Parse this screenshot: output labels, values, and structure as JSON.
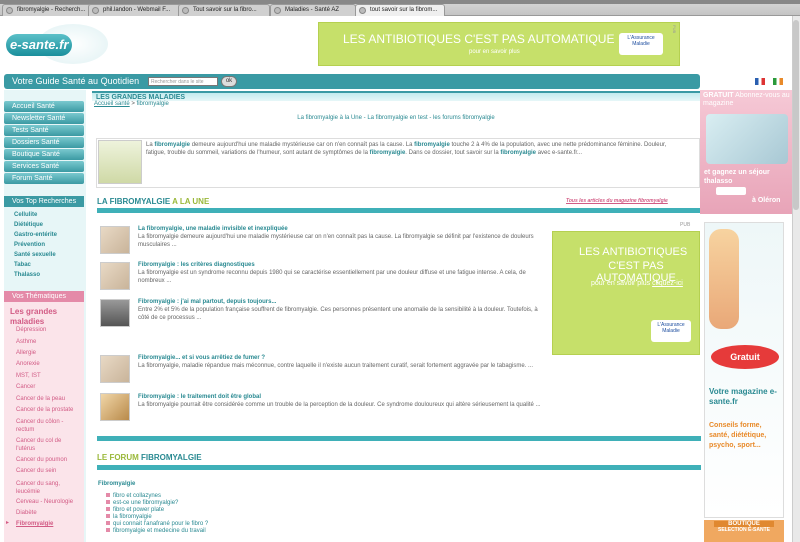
{
  "browser": {
    "tabs": [
      {
        "label": "fibromyalgie - Recherch..."
      },
      {
        "label": "phil.landon - Webmail F..."
      },
      {
        "label": "Tout savoir sur la fibro..."
      },
      {
        "label": "Maladies - Santé AZ"
      },
      {
        "label": "tout savoir sur la fibrom..."
      }
    ]
  },
  "site": {
    "logo": "e-sante.fr",
    "tagline": "Votre Guide Santé au Quotidien",
    "search_placeholder": "Rechercher dans le site",
    "go": "ok"
  },
  "ads": {
    "top_line": "LES ANTIBIOTIQUES C'EST PAS AUTOMATIQUE",
    "top_sub": "pour en savoir plus",
    "assurance": "L'Assurance Maladie",
    "pub": "PUB",
    "mid_line1": "LES ANTIBIOTIQUES",
    "mid_line2": "C'EST PAS AUTOMATIQUE",
    "mid_sub1": "pour en savoir plus",
    "mid_sub2": "cliquez-ici"
  },
  "nav": {
    "items": [
      "Accueil Santé",
      "Newsletter Santé",
      "Tests Santé",
      "Dossiers Santé",
      "Boutique Santé",
      "Services Santé",
      "Forum Santé"
    ],
    "top_searches_title": "Vos Top Recherches",
    "top_searches": [
      "Cellulite",
      "Diététique",
      "Gastro-entérite",
      "Prévention",
      "Santé sexuelle",
      "Tabac",
      "Thalasso"
    ],
    "themes_title": "Vos Thématiques Santé",
    "themes_group": "Les grandes maladies",
    "themes": [
      "Dépression",
      "Asthme",
      "Allergie",
      "Anorexie",
      "MST, IST",
      "Cancer",
      "Cancer de la peau",
      "Cancer de la prostate",
      "Cancer du côlon - rectum",
      "Cancer du col de l'utérus",
      "Cancer du poumon",
      "Cancer du sein",
      "Cancer du sang, leucémie",
      "Cerveau - Neurologie",
      "Diabète",
      "Fibromyalgie"
    ]
  },
  "main": {
    "section_title": "LES GRANDES MALADIES",
    "breadcrumb_home": "Accueil santé",
    "breadcrumb_sep": ">",
    "breadcrumb_current": "fibromyalgie",
    "sublinks": "La fibromyalgie à la Une - La fibromyalgie en test - les forums fibromyalgie",
    "intro_a": "La ",
    "intro_b": "fibromyalgie",
    "intro_c": " demeure aujourd'hui une maladie mystérieuse car on n'en connaît pas la cause. La ",
    "intro_d": "fibromyalgie",
    "intro_e": " touche 2 à 4% de la population, avec une nette prédominance féminine. Douleur, fatigue, trouble du sommeil, variations de l'humeur, sont autant de symptômes de la ",
    "intro_f": "fibromyalgie",
    "intro_g": ". Dans ce dossier, tout savoir sur la ",
    "intro_h": "fibromyalgie",
    "intro_i": " avec e-sante.fr...",
    "une_a": "LA FIBROMYALGIE",
    "une_b": " A LA UNE",
    "all_articles": "Tous les articles du magazine fibromyalgie",
    "articles": [
      {
        "title": "La fibromyalgie, une maladie invisible et inexpliquée",
        "text": "La fibromyalgie demeure aujourd'hui une maladie mystérieuse car on n'en connaît pas la cause. La fibromyalgie se définit par l'existence de douleurs musculaires ..."
      },
      {
        "title": "Fibromyalgie : les critères diagnostiques",
        "text": "La fibromyalgie est un syndrome reconnu depuis 1980 qui se caractérise essentiellement par une douleur diffuse et une fatigue intense. A cela, de nombreux ..."
      },
      {
        "title": "Fibromyalgie : j'ai mal partout, depuis toujours...",
        "text": "Entre 2% et 5% de la population française souffrent de fibromyalgie. Ces personnes présentent une anomalie de la sensibilité à la douleur. Toutefois, à côté de ce processus ..."
      },
      {
        "title": "Fibromyalgie... et si vous arrêtiez de fumer ?",
        "text": "La fibromyalgie, maladie répandue mais méconnue, contre laquelle il n'existe aucun traitement curatif, serait fortement aggravée par le tabagisme. ..."
      },
      {
        "title": "Fibromyalgie : le traitement doit être global",
        "text": "La fibromyalgie pourrait être considérée comme un trouble de la perception de la douleur. Ce syndrome douloureux qui altère sérieusement la qualité ..."
      }
    ],
    "forum_a": "LE FORUM",
    "forum_b": " FIBROMYALGIE",
    "forum_group": "Fibromyalgie",
    "forum_items": [
      "fibro et collazynes",
      "est-ce une fibromyalgie?",
      "fibro et power plate",
      "la fibromyalgie",
      "qui connait l'anafrané pour le fibro ?",
      "fibromyalgie et medecine du travail"
    ]
  },
  "right": {
    "promo1_a": "GRATUIT",
    "promo1_b": " Abonnez-vous au magazine",
    "promo1_text": "et gagnez un séjour thalasso",
    "promo1_place": "à Oléron",
    "promo2_free": "Gratuit",
    "promo2_title": "Votre magazine e-sante.fr",
    "promo2_text": "Conseils forme, santé, diététique, psycho, sport...",
    "boutique": "BOUTIQUE",
    "selection": "SELECTION E-SANTE"
  },
  "colors": {
    "teal": "#3a9aa4",
    "pink": "#d25b85",
    "lime": "#c6e06a"
  }
}
